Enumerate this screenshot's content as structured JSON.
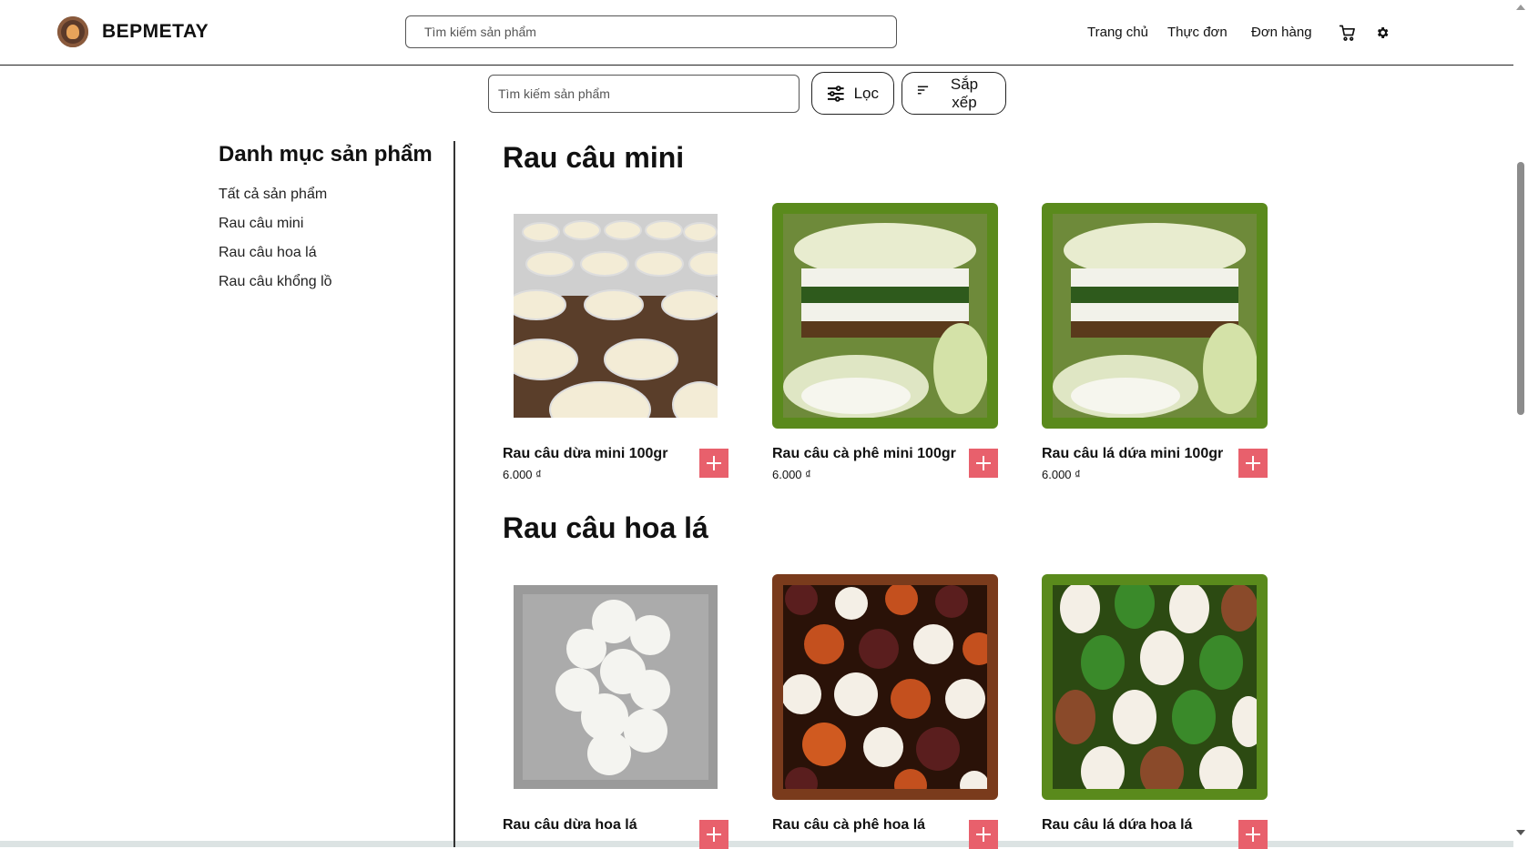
{
  "header": {
    "brand": "BEPMETAY",
    "search_placeholder": "Tìm kiếm sản phẩm",
    "nav": [
      "Trang chủ",
      "Thực đơn",
      "Đơn hàng"
    ],
    "icons": [
      "cart-icon",
      "gear-icon"
    ]
  },
  "toolbar": {
    "search_placeholder": "Tìm kiếm sản phẩm",
    "filter_label": "Lọc",
    "sort_label": "Sắp xếp"
  },
  "sidebar": {
    "title": "Danh mục sản phẩm",
    "items": [
      "Tất cả sản phẩm",
      "Rau câu mini",
      "Rau câu hoa lá",
      "Rau câu khổng lồ"
    ]
  },
  "sections": [
    {
      "title": "Rau câu mini",
      "products": [
        {
          "name": "Rau câu dừa mini 100gr",
          "price": "6.000 ₫",
          "frame": "#ffffff"
        },
        {
          "name": "Rau câu cà phê mini 100gr",
          "price": "6.000 ₫",
          "frame": "#5a8a1c"
        },
        {
          "name": "Rau câu lá dứa mini 100gr",
          "price": "6.000 ₫",
          "frame": "#5a8a1c"
        }
      ]
    },
    {
      "title": "Rau câu hoa lá",
      "products": [
        {
          "name": "Rau câu dừa hoa lá",
          "price": "",
          "frame": "#ffffff"
        },
        {
          "name": "Rau câu cà phê hoa lá",
          "price": "",
          "frame": "#7a3b1c"
        },
        {
          "name": "Rau câu lá dứa hoa lá",
          "price": "",
          "frame": "#5a8a1c"
        }
      ]
    }
  ],
  "colors": {
    "accent": "#e8606c",
    "green_frame": "#5a8a1c",
    "brown_frame": "#7a3b1c"
  }
}
